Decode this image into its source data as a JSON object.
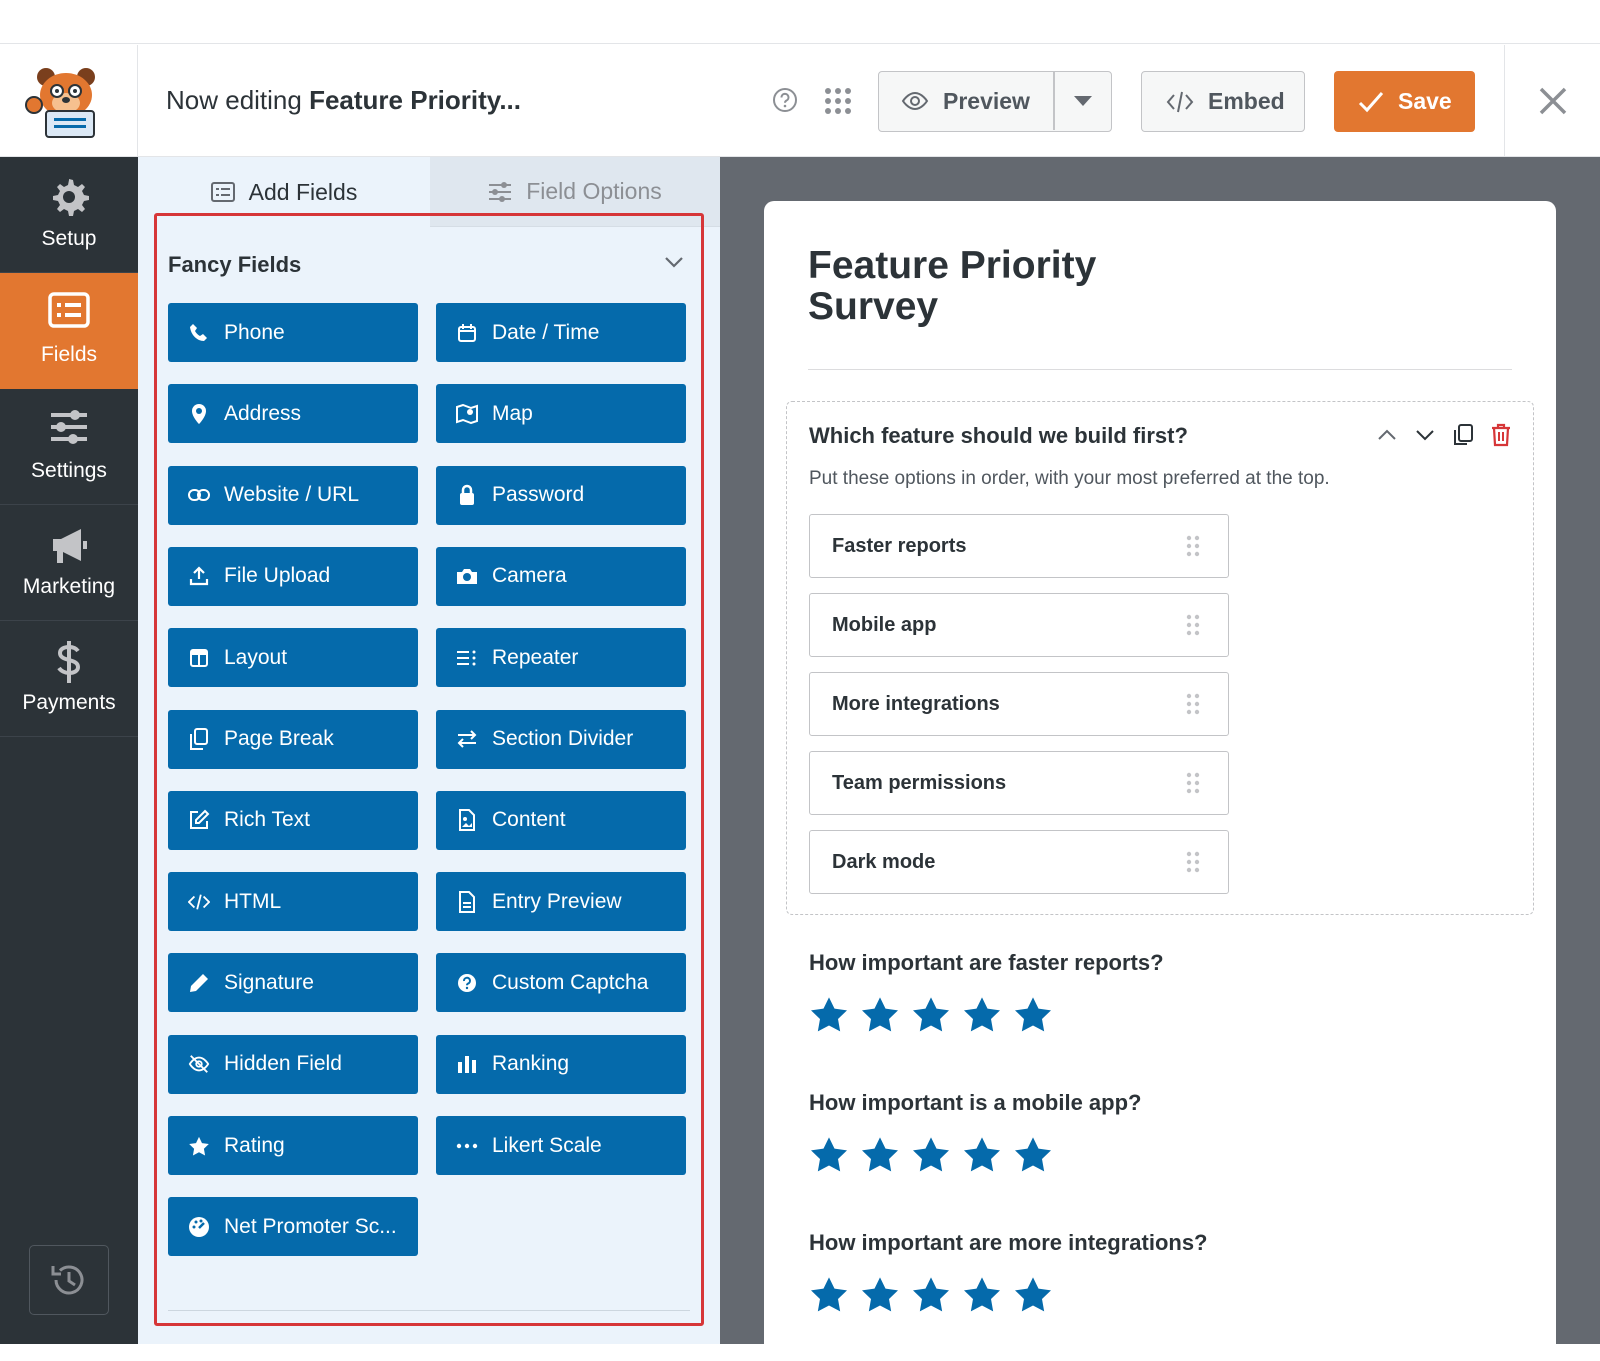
{
  "header": {
    "title_prefix": "Now editing ",
    "title_form": "Feature Priority...",
    "preview_label": "Preview",
    "embed_label": "Embed",
    "save_label": "Save",
    "help_icon": "question-circle-icon",
    "apps_icon": "grid-dots-icon",
    "close_icon": "close-icon"
  },
  "nav": {
    "items": [
      {
        "label": "Setup",
        "icon": "gear-icon"
      },
      {
        "label": "Fields",
        "icon": "list-form-icon",
        "active": true
      },
      {
        "label": "Settings",
        "icon": "sliders-icon"
      },
      {
        "label": "Marketing",
        "icon": "megaphone-icon"
      },
      {
        "label": "Payments",
        "icon": "dollar-icon"
      }
    ],
    "history_icon": "history-icon"
  },
  "panel": {
    "tabs": [
      {
        "label": "Add Fields",
        "icon": "list-icon",
        "active": true
      },
      {
        "label": "Field Options",
        "icon": "sliders-icon",
        "active": false
      }
    ],
    "section_title": "Fancy Fields",
    "fields": [
      {
        "label": "Phone",
        "icon": "phone-icon"
      },
      {
        "label": "Date / Time",
        "icon": "calendar-icon"
      },
      {
        "label": "Address",
        "icon": "map-pin-icon"
      },
      {
        "label": "Map",
        "icon": "map-icon"
      },
      {
        "label": "Website / URL",
        "icon": "link-icon"
      },
      {
        "label": "Password",
        "icon": "lock-icon"
      },
      {
        "label": "File Upload",
        "icon": "upload-icon"
      },
      {
        "label": "Camera",
        "icon": "camera-icon"
      },
      {
        "label": "Layout",
        "icon": "columns-icon"
      },
      {
        "label": "Repeater",
        "icon": "repeater-icon"
      },
      {
        "label": "Page Break",
        "icon": "copy-icon"
      },
      {
        "label": "Section Divider",
        "icon": "arrows-icon"
      },
      {
        "label": "Rich Text",
        "icon": "edit-icon"
      },
      {
        "label": "Content",
        "icon": "file-image-icon"
      },
      {
        "label": "HTML",
        "icon": "code-icon"
      },
      {
        "label": "Entry Preview",
        "icon": "file-text-icon"
      },
      {
        "label": "Signature",
        "icon": "pen-icon"
      },
      {
        "label": "Custom Captcha",
        "icon": "question-icon"
      },
      {
        "label": "Hidden Field",
        "icon": "eye-slash-icon"
      },
      {
        "label": "Ranking",
        "icon": "bar-chart-icon"
      },
      {
        "label": "Rating",
        "icon": "star-icon"
      },
      {
        "label": "Likert Scale",
        "icon": "ellipsis-icon"
      },
      {
        "label": "Net Promoter Sc...",
        "icon": "gauge-icon"
      }
    ]
  },
  "form": {
    "title": "Feature Priority Survey",
    "ranking_field": {
      "label": "Which feature should we build first?",
      "description": "Put these options in order, with your most preferred at the top.",
      "options": [
        "Faster reports",
        "Mobile app",
        "More integrations",
        "Team permissions",
        "Dark mode"
      ]
    },
    "rating_questions": [
      {
        "label": "How important are faster reports?",
        "stars": 5
      },
      {
        "label": "How important is a mobile app?",
        "stars": 5
      },
      {
        "label": "How important are more integrations?",
        "stars": 5
      }
    ],
    "colors": {
      "accent": "#e27730",
      "field_button": "#056aab",
      "star": "#056aab",
      "delete": "#d63638"
    }
  }
}
